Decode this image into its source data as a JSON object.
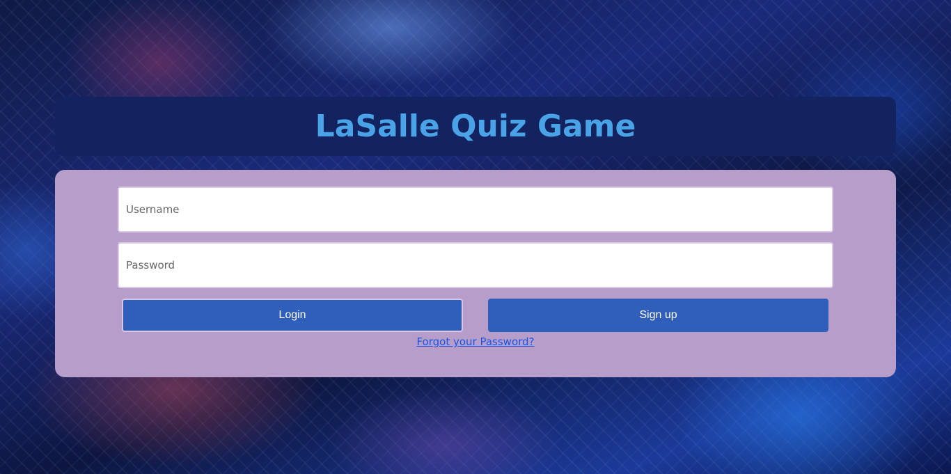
{
  "header": {
    "title": "LaSalle Quiz Game"
  },
  "form": {
    "username": {
      "placeholder": "Username",
      "value": ""
    },
    "password": {
      "placeholder": "Password",
      "value": ""
    },
    "login_label": "Login",
    "signup_label": "Sign up",
    "forgot_label": "Forgot your Password?"
  },
  "colors": {
    "header_bg": "#13235f",
    "title_color": "#4aa3e6",
    "panel_bg": "#b69dca",
    "button_bg": "#2f5fba",
    "link_color": "#1a55e0"
  }
}
